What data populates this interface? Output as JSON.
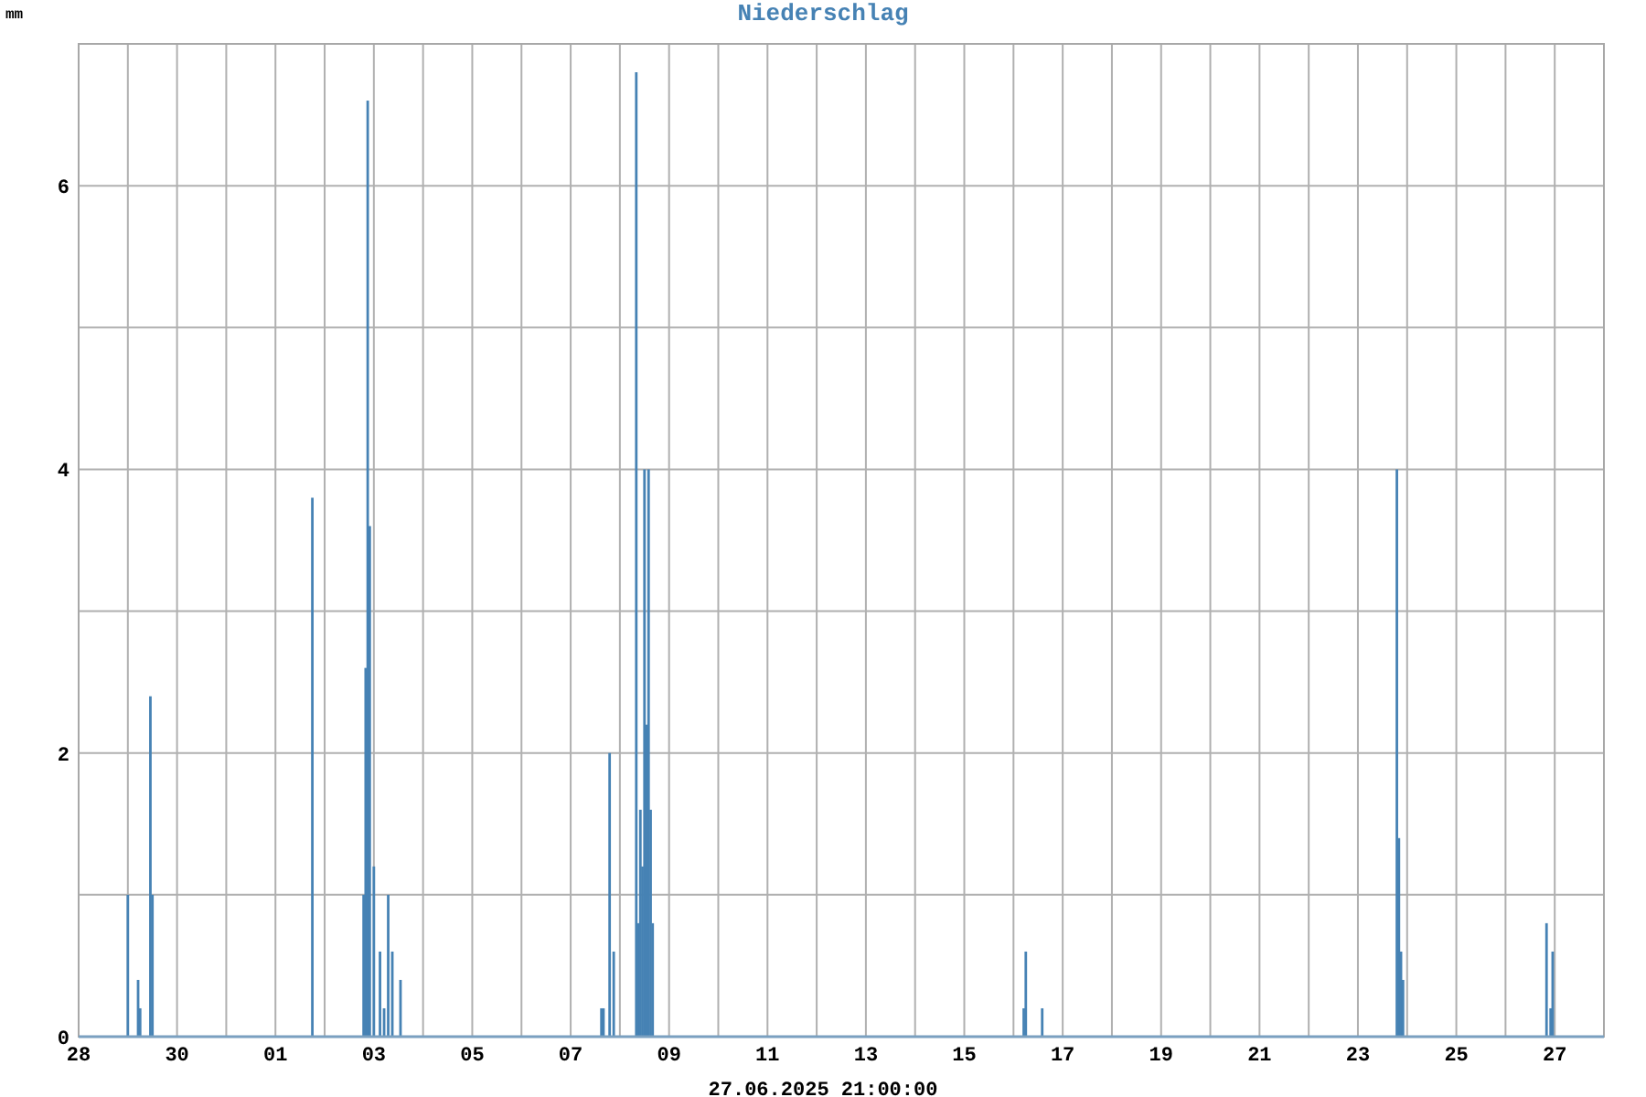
{
  "chart": {
    "chart_data": {
      "type": "bar",
      "title": "Niederschlag",
      "ylabel": "mm",
      "xlabel": "27.06.2025 21:00:00",
      "xlim": [
        "2025-05-28T00:00",
        "2025-06-28T00:00"
      ],
      "ylim": [
        0,
        7
      ],
      "xticks": [
        {
          "value": "2025-05-28T00:00",
          "label": "28"
        },
        {
          "value": "2025-05-30T00:00",
          "label": "30"
        },
        {
          "value": "2025-06-01T00:00",
          "label": "01"
        },
        {
          "value": "2025-06-03T00:00",
          "label": "03"
        },
        {
          "value": "2025-06-05T00:00",
          "label": "05"
        },
        {
          "value": "2025-06-07T00:00",
          "label": "07"
        },
        {
          "value": "2025-06-09T00:00",
          "label": "09"
        },
        {
          "value": "2025-06-11T00:00",
          "label": "11"
        },
        {
          "value": "2025-06-13T00:00",
          "label": "13"
        },
        {
          "value": "2025-06-15T00:00",
          "label": "15"
        },
        {
          "value": "2025-06-17T00:00",
          "label": "17"
        },
        {
          "value": "2025-06-19T00:00",
          "label": "19"
        },
        {
          "value": "2025-06-21T00:00",
          "label": "21"
        },
        {
          "value": "2025-06-23T00:00",
          "label": "23"
        },
        {
          "value": "2025-06-25T00:00",
          "label": "25"
        },
        {
          "value": "2025-06-27T00:00",
          "label": "27"
        }
      ],
      "yticks": [
        0,
        2,
        4,
        6
      ],
      "grid": true,
      "x": [
        "2025-05-29T00:00",
        "2025-05-29T05:00",
        "2025-05-29T06:00",
        "2025-05-29T11:00",
        "2025-05-29T12:00",
        "2025-06-01T18:00",
        "2025-06-02T19:00",
        "2025-06-02T20:00",
        "2025-06-02T21:00",
        "2025-06-02T22:00",
        "2025-06-03T00:00",
        "2025-06-03T03:00",
        "2025-06-03T05:00",
        "2025-06-03T07:00",
        "2025-06-03T09:00",
        "2025-06-03T13:00",
        "2025-06-07T15:00",
        "2025-06-07T16:00",
        "2025-06-07T19:00",
        "2025-06-07T21:00",
        "2025-06-08T08:00",
        "2025-06-08T09:00",
        "2025-06-08T10:00",
        "2025-06-08T11:00",
        "2025-06-08T12:00",
        "2025-06-08T13:00",
        "2025-06-08T14:00",
        "2025-06-08T15:00",
        "2025-06-08T16:00",
        "2025-06-16T05:00",
        "2025-06-16T06:00",
        "2025-06-16T14:00",
        "2025-06-23T19:00",
        "2025-06-23T20:00",
        "2025-06-23T21:00",
        "2025-06-23T22:00",
        "2025-06-26T20:00",
        "2025-06-26T22:00",
        "2025-06-26T23:00"
      ],
      "series": [
        {
          "color": "#4682b4",
          "values": [
            1.0,
            0.4,
            0.2,
            2.4,
            1.0,
            3.8,
            1.0,
            2.6,
            6.6,
            3.6,
            1.2,
            0.6,
            0.2,
            1.0,
            0.6,
            0.4,
            0.2,
            0.2,
            2.0,
            0.6,
            6.8,
            0.8,
            1.6,
            1.2,
            4.0,
            2.2,
            4.0,
            1.6,
            0.8,
            0.2,
            0.6,
            0.2,
            4.0,
            1.4,
            0.6,
            0.4,
            0.8,
            0.2,
            0.6
          ]
        }
      ]
    }
  }
}
